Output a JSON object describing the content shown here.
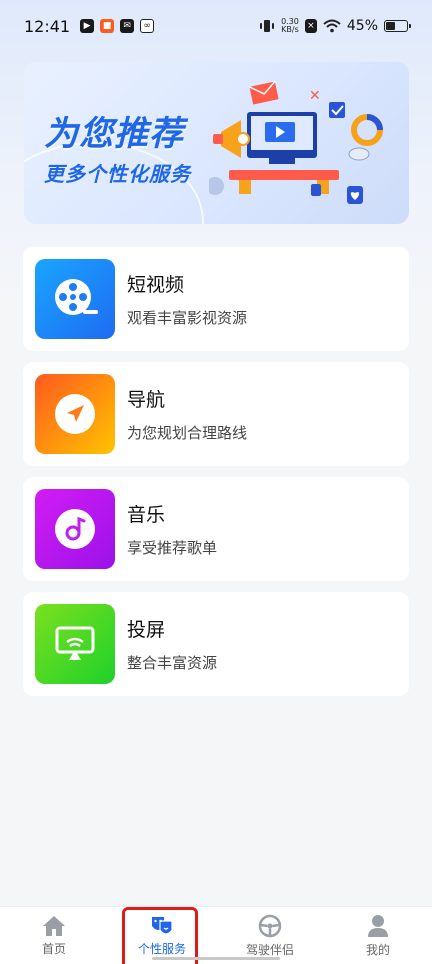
{
  "status_bar": {
    "time": "12:41",
    "net_speed_value": "0.30",
    "net_speed_unit": "KB/s",
    "battery": "45%",
    "battery_level": 0.45
  },
  "banner": {
    "title": "为您推荐",
    "subtitle": "更多个性化服务"
  },
  "services": [
    {
      "title": "短视频",
      "desc": "观看丰富影视资源",
      "icon": "film-reel-icon",
      "gradient": [
        "#1aa5ff",
        "#1e6cf2"
      ]
    },
    {
      "title": "导航",
      "desc": "为您规划合理路线",
      "icon": "navigation-arrow-icon",
      "gradient": [
        "#ff5a1f",
        "#ffc300"
      ]
    },
    {
      "title": "音乐",
      "desc": "享受推荐歌单",
      "icon": "music-note-icon",
      "gradient": [
        "#d31cf5",
        "#9b12e8"
      ]
    },
    {
      "title": "投屏",
      "desc": "整合丰富资源",
      "icon": "screen-cast-icon",
      "gradient": [
        "#7be01f",
        "#1fd12a"
      ]
    }
  ],
  "bottom_nav": [
    {
      "label": "首页",
      "icon": "home-icon",
      "active": false
    },
    {
      "label": "个性服务",
      "icon": "theater-mask-icon",
      "active": true
    },
    {
      "label": "驾驶伴侣",
      "icon": "steering-wheel-icon",
      "active": false
    },
    {
      "label": "我的",
      "icon": "person-icon",
      "active": false
    }
  ],
  "colors": {
    "accent": "#1f67e8",
    "highlight_box": "#e01919"
  }
}
